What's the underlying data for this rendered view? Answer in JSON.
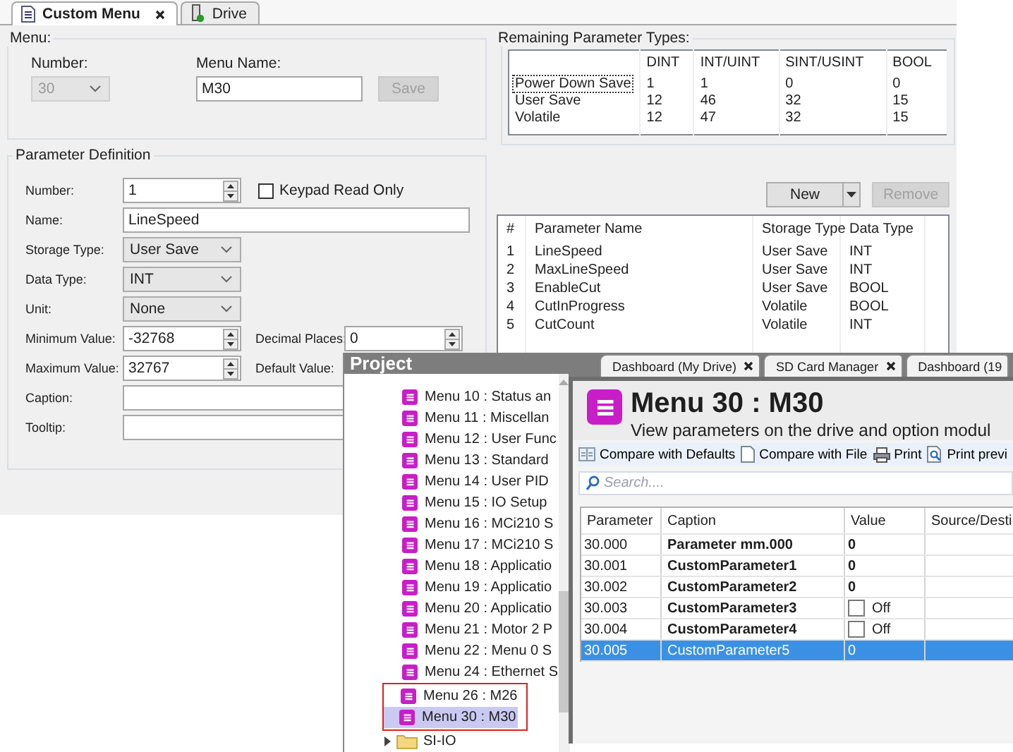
{
  "editor_tabs": [
    {
      "label": "Custom Menu",
      "selected": true,
      "closable": true
    },
    {
      "label": "Drive",
      "selected": false,
      "closable": false
    }
  ],
  "menu_group": {
    "title": "Menu:",
    "number_label": "Number:",
    "number_value": "30",
    "number_disabled": true,
    "name_label": "Menu Name:",
    "name_value": "M30",
    "save_button": "Save",
    "save_disabled": true
  },
  "remaining_types": {
    "title": "Remaining Parameter Types:",
    "columns": [
      "DINT",
      "INT/UINT",
      "SINT/USINT",
      "BOOL"
    ],
    "rows": [
      {
        "label": "Power Down Save",
        "focused": true,
        "values": [
          "1",
          "1",
          "0",
          "0"
        ]
      },
      {
        "label": "User Save",
        "focused": false,
        "values": [
          "12",
          "46",
          "32",
          "15"
        ]
      },
      {
        "label": "Volatile",
        "focused": false,
        "values": [
          "12",
          "47",
          "32",
          "15"
        ]
      }
    ]
  },
  "parameter_definition": {
    "title": "Parameter Definition",
    "rows": [
      [
        {
          "kind": "spin",
          "label": "Number:",
          "value": "1"
        },
        {
          "kind": "checkbox",
          "label": "Keypad Read Only",
          "checked": false
        }
      ],
      [
        {
          "kind": "text",
          "label": "Name:",
          "value": "LineSpeed"
        }
      ],
      [
        {
          "kind": "select",
          "label": "Storage Type:",
          "value": "User Save"
        }
      ],
      [
        {
          "kind": "select",
          "label": "Data Type:",
          "value": "INT"
        }
      ],
      [
        {
          "kind": "select",
          "label": "Unit:",
          "value": "None"
        }
      ],
      [
        {
          "kind": "spin",
          "label": "Minimum Value:",
          "value": "-32768"
        },
        {
          "kind": "spin",
          "label": "Decimal Places:",
          "value": "0"
        }
      ],
      [
        {
          "kind": "spin",
          "label": "Maximum Value:",
          "value": "32767"
        },
        {
          "kind": "label",
          "label": "Default Value:"
        }
      ],
      [
        {
          "kind": "text",
          "label": "Caption:"
        }
      ],
      [
        {
          "kind": "text",
          "label": "Tooltip:"
        }
      ]
    ]
  },
  "parameter_actions": {
    "new_button": "New",
    "remove_button": "Remove",
    "remove_disabled": true
  },
  "parameter_table": {
    "columns": [
      "#",
      "Parameter Name",
      "Storage Type",
      "Data Type"
    ],
    "rows": [
      [
        "1",
        "LineSpeed",
        "User Save",
        "INT"
      ],
      [
        "2",
        "MaxLineSpeed",
        "User Save",
        "INT"
      ],
      [
        "3",
        "EnableCut",
        "User Save",
        "BOOL"
      ],
      [
        "4",
        "CutInProgress",
        "Volatile",
        "BOOL"
      ],
      [
        "5",
        "CutCount",
        "Volatile",
        "INT"
      ]
    ]
  },
  "project_panel": {
    "title": "Project",
    "items": [
      {
        "kind": "menu",
        "label": "Menu 10 : Status an",
        "selected": false,
        "annotated": false
      },
      {
        "kind": "menu",
        "label": "Menu 11 : Miscellan",
        "selected": false,
        "annotated": false
      },
      {
        "kind": "menu",
        "label": "Menu 12 : User Func",
        "selected": false,
        "annotated": false
      },
      {
        "kind": "menu",
        "label": "Menu 13 : Standard",
        "selected": false,
        "annotated": false
      },
      {
        "kind": "menu",
        "label": "Menu 14 : User PID",
        "selected": false,
        "annotated": false
      },
      {
        "kind": "menu",
        "label": "Menu 15 : IO Setup",
        "selected": false,
        "annotated": false
      },
      {
        "kind": "menu",
        "label": "Menu 16 : MCi210 S",
        "selected": false,
        "annotated": false
      },
      {
        "kind": "menu",
        "label": "Menu 17 : MCi210 S",
        "selected": false,
        "annotated": false
      },
      {
        "kind": "menu",
        "label": "Menu 18 : Applicatio",
        "selected": false,
        "annotated": false
      },
      {
        "kind": "menu",
        "label": "Menu 19 : Applicatio",
        "selected": false,
        "annotated": false
      },
      {
        "kind": "menu",
        "label": "Menu 20 : Applicatio",
        "selected": false,
        "annotated": false
      },
      {
        "kind": "menu",
        "label": "Menu 21 : Motor 2 P",
        "selected": false,
        "annotated": false
      },
      {
        "kind": "menu",
        "label": "Menu 22 : Menu 0 S",
        "selected": false,
        "annotated": false
      },
      {
        "kind": "menu",
        "label": "Menu 24 : Ethernet S",
        "selected": false,
        "annotated": false
      },
      {
        "kind": "menu",
        "label": "Menu 26 : M26",
        "selected": false,
        "annotated": true
      },
      {
        "kind": "menu",
        "label": "Menu 30 : M30",
        "selected": true,
        "annotated": true
      },
      {
        "kind": "folder",
        "label": "SI-IO",
        "selected": false,
        "annotated": false,
        "expanded": false
      }
    ]
  },
  "document_tabs": [
    {
      "label": "Dashboard (My Drive)",
      "closable": true
    },
    {
      "label": "SD Card Manager",
      "closable": true
    },
    {
      "label": "Dashboard (19",
      "closable": false
    }
  ],
  "parameter_view": {
    "title": "Menu 30 : M30",
    "subtitle": "View parameters on the drive and option modul",
    "toolbar": [
      {
        "label": "Compare with Defaults"
      },
      {
        "label": "Compare with File"
      },
      {
        "label": "Print"
      },
      {
        "label": "Print previ"
      }
    ],
    "search": {
      "placeholder": "Search...."
    },
    "table": {
      "columns": [
        "Parameter",
        "Caption",
        "Value",
        "Source/Desti"
      ],
      "rows": [
        {
          "parameter": "30.000",
          "caption": "Parameter mm.000",
          "kind": "number",
          "value": "0",
          "selected": false
        },
        {
          "parameter": "30.001",
          "caption": "CustomParameter1",
          "kind": "number",
          "value": "0",
          "selected": false
        },
        {
          "parameter": "30.002",
          "caption": "CustomParameter2",
          "kind": "number",
          "value": "0",
          "selected": false
        },
        {
          "parameter": "30.003",
          "caption": "CustomParameter3",
          "kind": "toggle",
          "value": "Off",
          "checked": false,
          "selected": false
        },
        {
          "parameter": "30.004",
          "caption": "CustomParameter4",
          "kind": "toggle",
          "value": "Off",
          "checked": false,
          "selected": false
        },
        {
          "parameter": "30.005",
          "caption": "CustomParameter5",
          "kind": "number",
          "value": "0",
          "selected": true
        }
      ]
    }
  }
}
